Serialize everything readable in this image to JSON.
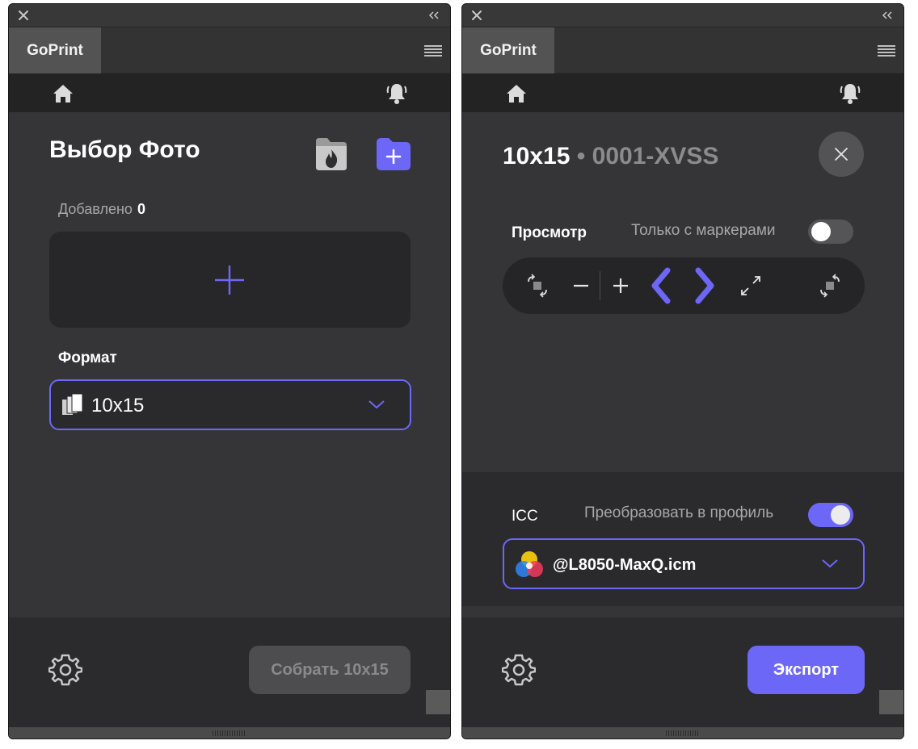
{
  "left_panel": {
    "tab_label": "GoPrint",
    "title": "Выбор Фото",
    "added_label": "Добавлено",
    "added_count": "0",
    "format_label": "Формат",
    "format_value": "10x15",
    "collect_button": "Собрать 10x15",
    "collect_button_enabled": false
  },
  "right_panel": {
    "tab_label": "GoPrint",
    "title_format": "10x15",
    "title_separator": "•",
    "title_code": "0001-XVSS",
    "preview_label": "Просмотр",
    "markers_only_label": "Только с маркерами",
    "markers_only_toggle": false,
    "icc_label": "ICC",
    "convert_profile_label": "Преобразовать в профиль",
    "convert_profile_toggle": true,
    "icc_profile_value": "@L8050-MaxQ.icm",
    "export_button": "Экспорт"
  },
  "colors": {
    "accent": "#6d67f7",
    "panel_bg": "#353538",
    "footer_bg": "#2b2b2d",
    "text_muted": "#a7a7a9"
  },
  "icons": [
    "close-icon",
    "collapse-icon",
    "panel-menu-icon",
    "home-icon",
    "bell-icon",
    "fire-folder-icon",
    "add-folder-icon",
    "plus-icon",
    "format-stack-icon",
    "chevron-down-icon",
    "gear-icon",
    "rotate-left-icon",
    "zoom-out-icon",
    "zoom-in-icon",
    "prev-arrow-icon",
    "next-arrow-icon",
    "fullscreen-icon",
    "rotate-right-icon",
    "color-profile-icon"
  ]
}
